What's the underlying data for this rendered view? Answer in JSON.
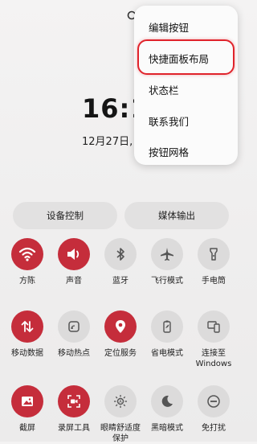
{
  "clock": {
    "time": "16:1",
    "date": "12月27日, 星"
  },
  "quick_panel": {
    "device_control": "设备控制",
    "media_output": "媒体输出",
    "tiles": [
      {
        "label": "方陈",
        "icon": "wifi-icon",
        "state": "on"
      },
      {
        "label": "声音",
        "icon": "volume-icon",
        "state": "on"
      },
      {
        "label": "蓝牙",
        "icon": "bluetooth-icon",
        "state": "off"
      },
      {
        "label": "飞行模式",
        "icon": "airplane-icon",
        "state": "off"
      },
      {
        "label": "手电筒",
        "icon": "flashlight-icon",
        "state": "off"
      },
      {
        "label": "移动数据",
        "icon": "mobile-data-icon",
        "state": "on"
      },
      {
        "label": "移动热点",
        "icon": "hotspot-icon",
        "state": "off"
      },
      {
        "label": "定位服务",
        "icon": "location-icon",
        "state": "on"
      },
      {
        "label": "省电模式",
        "icon": "battery-saver-icon",
        "state": "off"
      },
      {
        "label": "连接至\nWindows",
        "icon": "link-to-windows-icon",
        "state": "off"
      },
      {
        "label": "截屏",
        "icon": "screenshot-icon",
        "state": "on"
      },
      {
        "label": "录屏工具",
        "icon": "screen-recorder-icon",
        "state": "on"
      },
      {
        "label": "眼睛舒适度\n保护",
        "icon": "eye-comfort-icon",
        "state": "off"
      },
      {
        "label": "黑暗模式",
        "icon": "dark-mode-icon",
        "state": "off"
      },
      {
        "label": "免打扰",
        "icon": "do-not-disturb-icon",
        "state": "off"
      }
    ]
  },
  "menu": {
    "items": [
      "编辑按钮",
      "快捷面板布局",
      "状态栏",
      "联系我们",
      "按钮网格"
    ],
    "highlighted_index": 1
  },
  "colors": {
    "accent": "#c52d3b",
    "highlight_border": "#e0232b",
    "inactive": "#dcdbdb"
  }
}
